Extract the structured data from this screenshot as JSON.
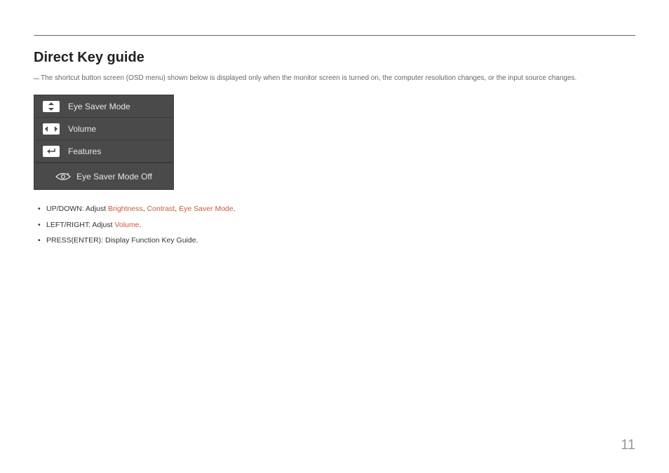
{
  "title": "Direct Key guide",
  "note": "The shortcut button screen (OSD menu) shown below is displayed only when the monitor screen is turned on, the computer resolution changes, or the input source changes.",
  "osd": {
    "rows": [
      {
        "label": "Eye Saver Mode"
      },
      {
        "label": "Volume"
      },
      {
        "label": "Features"
      }
    ],
    "status": "Eye Saver Mode Off"
  },
  "bullets": [
    {
      "prefix": "UP/DOWN: Adjust ",
      "refs": [
        "Brightness",
        "Contrast",
        "Eye Saver Mode"
      ],
      "suffix": "."
    },
    {
      "prefix": "LEFT/RIGHT: Adjust ",
      "refs": [
        "Volume"
      ],
      "suffix": "."
    },
    {
      "prefix": "PRESS(ENTER): Display Function Key Guide.",
      "refs": [],
      "suffix": ""
    }
  ],
  "pageNumber": "11"
}
